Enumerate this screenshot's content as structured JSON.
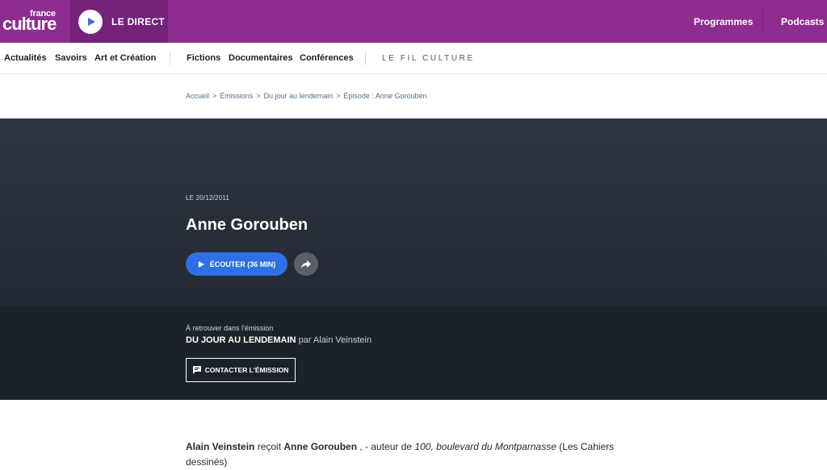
{
  "brand": {
    "line1": "france",
    "line2": "culture"
  },
  "live": {
    "label": "LE DIRECT"
  },
  "topnav": {
    "programmes": "Programmes",
    "podcasts": "Podcasts"
  },
  "subnav": {
    "items": [
      "Actualités",
      "Savoirs",
      "Art et Création",
      "Fictions",
      "Documentaires",
      "Conférences"
    ],
    "fil": "LE FIL CULTURE"
  },
  "breadcrumb": [
    "Accueil",
    "Émissions",
    "Du jour au lendemain",
    "Épisode : Anne Gorouben"
  ],
  "breadcrumb_sep": ">",
  "episode": {
    "date": "LE 20/12/2011",
    "title": "Anne Gorouben",
    "listen_label": "ÉCOUTER (36 MIN)"
  },
  "emission": {
    "intro": "À retrouver dans l'émission",
    "name": "DU JOUR AU LENDEMAIN",
    "by": "par Alain Veinstein",
    "contact_label": "CONTACTER L'ÉMISSION"
  },
  "body": {
    "host": "Alain Veinstein",
    "verb": " reçoit ",
    "guest": "Anne Gorouben",
    "mid": " , - auteur de ",
    "book": "100, boulevard du Montparnasse",
    "tail": " (Les Cahiers dessinés)"
  },
  "colors": {
    "brand_purple": "#8e2d8f",
    "live_purple": "#74227a",
    "accent_blue": "#2e6fe6",
    "hero_dark": "#2d3540",
    "band_dark": "#1c2229"
  }
}
